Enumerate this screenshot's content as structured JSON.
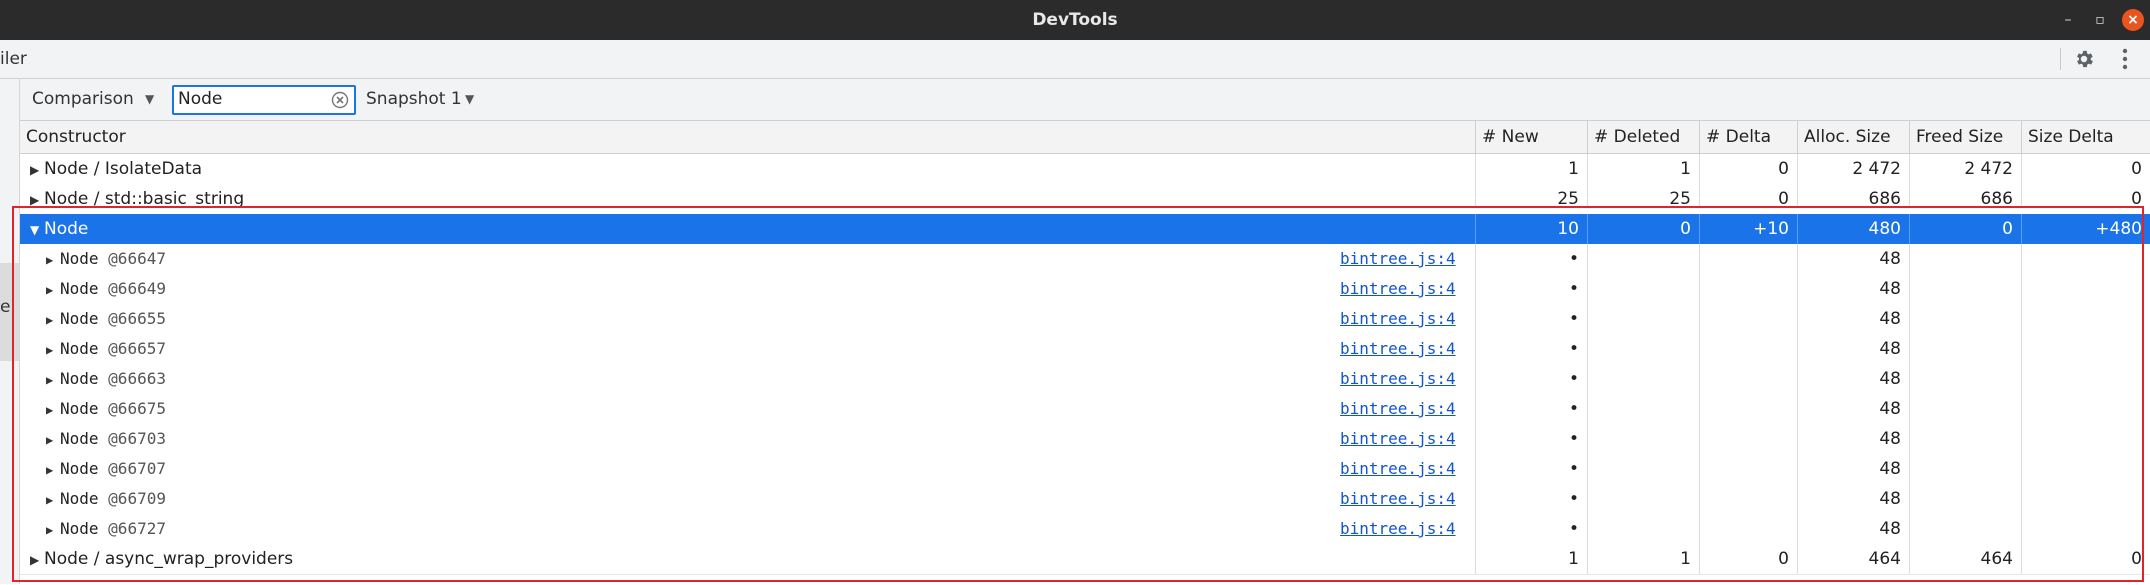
{
  "window": {
    "title": "DevTools",
    "minimize": "–",
    "restore": "▫",
    "close": "×"
  },
  "tabbar": {
    "panel_fragment": "iler"
  },
  "leftstrip": {
    "fragment": "e"
  },
  "toolbar": {
    "view": "Comparison",
    "filter_value": "Node",
    "snapshot": "Snapshot 1"
  },
  "columns": [
    "Constructor",
    "# New",
    "# Deleted",
    "# Delta",
    "Alloc. Size",
    "Freed Size",
    "Size Delta"
  ],
  "rows": [
    {
      "kind": "group",
      "name": "Node / IsolateData",
      "new": "1",
      "deleted": "1",
      "delta": "0",
      "alloc": "2 472",
      "freed": "2 472",
      "size_delta": "0"
    },
    {
      "kind": "group",
      "name": "Node / std::basic_string",
      "new": "25",
      "deleted": "25",
      "delta": "0",
      "alloc": "686",
      "freed": "686",
      "size_delta": "0"
    },
    {
      "kind": "selected",
      "name": "Node",
      "new": "10",
      "deleted": "0",
      "delta": "+10",
      "alloc": "480",
      "freed": "0",
      "size_delta": "+480"
    },
    {
      "kind": "child",
      "name": "Node",
      "addr": "@66647",
      "link": "bintree.js:4",
      "new": "•",
      "alloc": "48"
    },
    {
      "kind": "child",
      "name": "Node",
      "addr": "@66649",
      "link": "bintree.js:4",
      "new": "•",
      "alloc": "48"
    },
    {
      "kind": "child",
      "name": "Node",
      "addr": "@66655",
      "link": "bintree.js:4",
      "new": "•",
      "alloc": "48"
    },
    {
      "kind": "child",
      "name": "Node",
      "addr": "@66657",
      "link": "bintree.js:4",
      "new": "•",
      "alloc": "48"
    },
    {
      "kind": "child",
      "name": "Node",
      "addr": "@66663",
      "link": "bintree.js:4",
      "new": "•",
      "alloc": "48"
    },
    {
      "kind": "child",
      "name": "Node",
      "addr": "@66675",
      "link": "bintree.js:4",
      "new": "•",
      "alloc": "48"
    },
    {
      "kind": "child",
      "name": "Node",
      "addr": "@66703",
      "link": "bintree.js:4",
      "new": "•",
      "alloc": "48"
    },
    {
      "kind": "child",
      "name": "Node",
      "addr": "@66707",
      "link": "bintree.js:4",
      "new": "•",
      "alloc": "48"
    },
    {
      "kind": "child",
      "name": "Node",
      "addr": "@66709",
      "link": "bintree.js:4",
      "new": "•",
      "alloc": "48"
    },
    {
      "kind": "child",
      "name": "Node",
      "addr": "@66727",
      "link": "bintree.js:4",
      "new": "•",
      "alloc": "48"
    },
    {
      "kind": "group",
      "name": "Node / async_wrap_providers",
      "new": "1",
      "deleted": "1",
      "delta": "0",
      "alloc": "464",
      "freed": "464",
      "size_delta": "0"
    }
  ],
  "colors": {
    "selection": "#1a73e8",
    "highlight_border": "#e0242a",
    "link": "#1155cc"
  },
  "icons": {
    "expand": "triangle-right-icon",
    "collapse": "triangle-down-icon",
    "clear": "clear-circle-icon",
    "settings": "gear-icon",
    "menu": "kebab-icon"
  }
}
